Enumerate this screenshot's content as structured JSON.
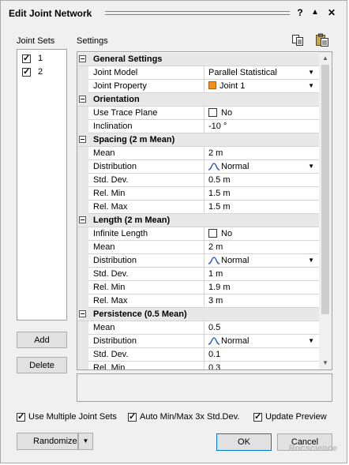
{
  "window": {
    "title": "Edit Joint Network",
    "help_label": "?",
    "up_label": "▲",
    "close_label": "✕"
  },
  "joint_sets": {
    "label": "Joint Sets",
    "items": [
      {
        "label": "1",
        "checked": true
      },
      {
        "label": "2",
        "checked": true
      }
    ],
    "add_label": "Add",
    "delete_label": "Delete"
  },
  "settings": {
    "label": "Settings",
    "icons": [
      "copy-icon",
      "paste-icon"
    ],
    "rows": [
      {
        "type": "category",
        "title": "General Settings"
      },
      {
        "type": "prop",
        "name": "Joint Model",
        "value": "Parallel Statistical",
        "dropdown": true
      },
      {
        "type": "prop",
        "name": "Joint Property",
        "value": "Joint 1",
        "dropdown": true,
        "swatch": "#f29019"
      },
      {
        "type": "category",
        "title": "Orientation"
      },
      {
        "type": "prop",
        "name": "Use Trace Plane",
        "value": "No",
        "checkbox": true
      },
      {
        "type": "prop",
        "name": "Inclination",
        "value": "-10 °"
      },
      {
        "type": "category",
        "title": "Spacing   (2 m  Mean)"
      },
      {
        "type": "prop",
        "name": "Mean",
        "value": "2 m"
      },
      {
        "type": "prop",
        "name": "Distribution",
        "value": "Normal",
        "dropdown": true,
        "curve": true
      },
      {
        "type": "prop",
        "name": "Std. Dev.",
        "value": "0.5 m"
      },
      {
        "type": "prop",
        "name": "Rel. Min",
        "value": "1.5 m"
      },
      {
        "type": "prop",
        "name": "Rel. Max",
        "value": "1.5 m"
      },
      {
        "type": "category",
        "title": "Length   (2 m  Mean)"
      },
      {
        "type": "prop",
        "name": "Infinite Length",
        "value": "No",
        "checkbox": true
      },
      {
        "type": "prop",
        "name": "Mean",
        "value": "2 m"
      },
      {
        "type": "prop",
        "name": "Distribution",
        "value": "Normal",
        "dropdown": true,
        "curve": true
      },
      {
        "type": "prop",
        "name": "Std. Dev.",
        "value": "1 m"
      },
      {
        "type": "prop",
        "name": "Rel. Min",
        "value": "1.9 m"
      },
      {
        "type": "prop",
        "name": "Rel. Max",
        "value": "3 m"
      },
      {
        "type": "category",
        "title": "Persistence   (0.5  Mean)"
      },
      {
        "type": "prop",
        "name": "Mean",
        "value": "0.5"
      },
      {
        "type": "prop",
        "name": "Distribution",
        "value": "Normal",
        "dropdown": true,
        "curve": true
      },
      {
        "type": "prop",
        "name": "Std. Dev.",
        "value": "0.1"
      },
      {
        "type": "prop",
        "name": "Rel. Min",
        "value": "0.3"
      }
    ]
  },
  "options": {
    "multiple_sets": {
      "label": "Use Multiple Joint Sets",
      "checked": true
    },
    "auto_minmax": {
      "label": "Auto Min/Max 3x Std.Dev.",
      "checked": true
    },
    "update_preview": {
      "label": "Update Preview",
      "checked": true
    }
  },
  "footer": {
    "randomize_label": "Randomize",
    "ok_label": "OK",
    "cancel_label": "Cancel"
  },
  "watermark": "Rocscience"
}
